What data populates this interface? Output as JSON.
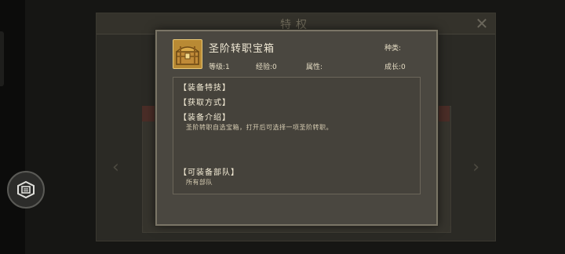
{
  "background": {
    "window_title": "特权",
    "close_glyph": "✕",
    "left_arrow": "‹",
    "right_arrow": "›"
  },
  "popup": {
    "item_name": "圣阶转职宝箱",
    "item_icon": "treasure-chest-icon",
    "type_label": "种类:",
    "level_label": "等级:",
    "level_value": "1",
    "exp_label": "经验:",
    "exp_value": "0",
    "attr_label": "属性:",
    "growth_label": "成长:",
    "growth_value": "0",
    "sections": {
      "skill": "【装备特技】",
      "obtain": "【获取方式】",
      "intro": "【装备介绍】",
      "intro_text": "圣阶转职自选宝箱，打开后可选择一项圣阶转职。",
      "units": "【可装备部队】",
      "units_text": "所有部队"
    }
  },
  "colors": {
    "popup_bg": "#4a4740",
    "popup_border": "#7a7566",
    "chest_gold": "#c79a3c"
  }
}
